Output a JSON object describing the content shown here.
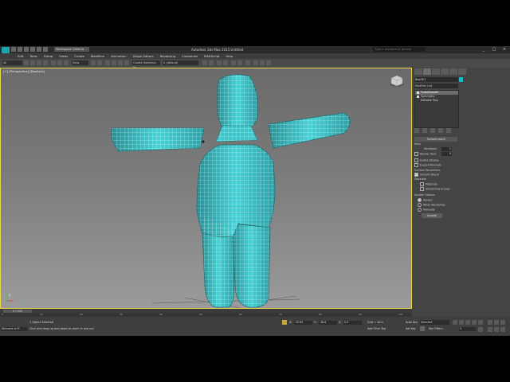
{
  "window": {
    "title": "Autodesk 3ds Max 2015    Untitled",
    "workspace": "Workspace: Default",
    "search_placeholder": "Type a keyword or phrase",
    "controls": [
      "_",
      "□",
      "×"
    ]
  },
  "menu": [
    "Edit",
    "Tools",
    "Group",
    "Views",
    "Create",
    "Modifiers",
    "Animation",
    "Graph Editors",
    "Rendering",
    "Customize",
    "MAXScript",
    "Help"
  ],
  "toolbar": {
    "selection_filter": "All",
    "reference_coord": "View",
    "named_selection": "Create Selection Se",
    "layer_box": "0 (default)"
  },
  "viewport": {
    "label": "[+] [Perspective] [Realistic]",
    "axis_label": "y",
    "mesh_color": "#3fc4c8",
    "border_color": "#e8d84a"
  },
  "command_panel": {
    "object_name": "Box001",
    "object_color": "#1fb6c9",
    "modifier_list": "Modifier List",
    "stack": [
      {
        "label": "TurboSmooth",
        "active": true
      },
      {
        "label": "Symmetry",
        "active": false
      },
      {
        "label": "Editable Poly",
        "active": false
      }
    ],
    "turbosmooth": {
      "title": "TurboSmooth",
      "main_label": "Main",
      "iterations_label": "Iterations:",
      "iterations": "1",
      "render_iters_label": "Render Iters:",
      "render_iters": "0",
      "isoline_display": "Isoline Display",
      "explicit_normals": "Explicit Normals",
      "surface_params": "Surface Parameters",
      "smooth_result": "Smooth Result",
      "separate": "Separate",
      "materials": "Materials",
      "smoothing_groups": "Smoothing Groups",
      "update_options": "Update Options",
      "always": "Always",
      "when_rendering": "When Rendering",
      "manually": "Manually",
      "update_button": "Update"
    }
  },
  "timeline": {
    "frame": "0 / 100",
    "ticks": [
      "0",
      "10",
      "20",
      "30",
      "40",
      "50",
      "60",
      "70",
      "80",
      "90",
      "100"
    ]
  },
  "status": {
    "selected": "1 Object Selected",
    "prompt": "Click and drag up-and-down to zoom in and out",
    "welcome": "Welcome to M",
    "x_label": "X:",
    "x_value": "-35.85",
    "y_label": "Y:",
    "y_value": "-36.6",
    "z_label": "Z:",
    "z_value": "0.0",
    "grid": "Grid = 10.0",
    "add_time_tag": "Add Time Tag",
    "auto_key": "Auto Key",
    "set_key": "Set Key",
    "selected_dropdown": "Selected",
    "key_filters": "Key Filters...",
    "frame_field": "0"
  }
}
